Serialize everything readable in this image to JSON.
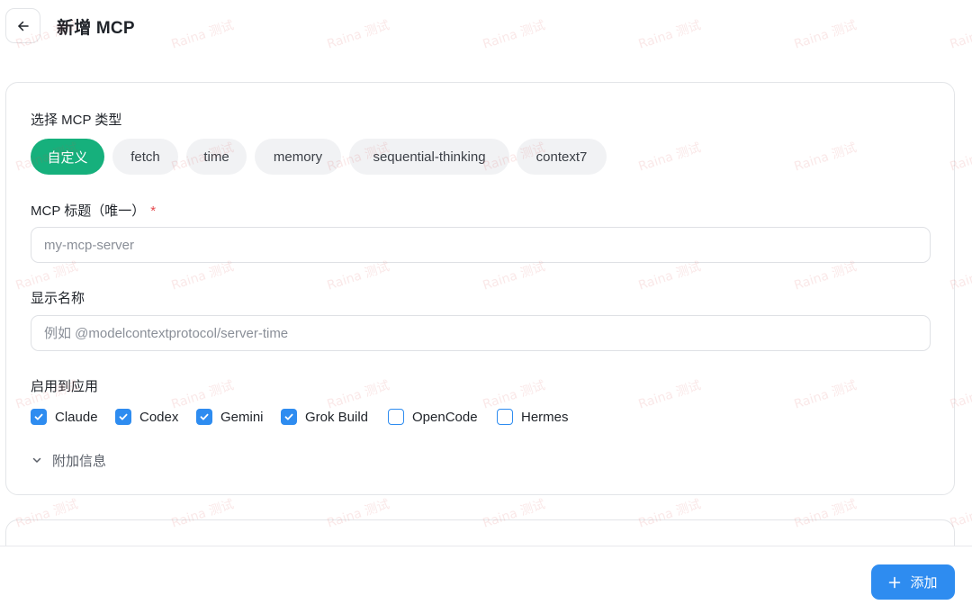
{
  "header": {
    "title": "新增 MCP"
  },
  "mcp_type": {
    "label": "选择 MCP 类型",
    "chips": [
      {
        "label": "自定义",
        "active": true
      },
      {
        "label": "fetch",
        "active": false
      },
      {
        "label": "time",
        "active": false
      },
      {
        "label": "memory",
        "active": false
      },
      {
        "label": "sequential-thinking",
        "active": false
      },
      {
        "label": "context7",
        "active": false
      }
    ]
  },
  "title_field": {
    "label": "MCP 标题（唯一）",
    "required_mark": "*",
    "value": "",
    "placeholder": "my-mcp-server"
  },
  "display_name_field": {
    "label": "显示名称",
    "value": "",
    "placeholder": "例如 @modelcontextprotocol/server-time"
  },
  "apps": {
    "label": "启用到应用",
    "items": [
      {
        "label": "Claude",
        "checked": true
      },
      {
        "label": "Codex",
        "checked": true
      },
      {
        "label": "Gemini",
        "checked": true
      },
      {
        "label": "Grok Build",
        "checked": true
      },
      {
        "label": "OpenCode",
        "checked": false
      },
      {
        "label": "Hermes",
        "checked": false
      }
    ]
  },
  "extra_info": {
    "label": "附加信息",
    "icon": "chevron-down-icon"
  },
  "footer": {
    "add_label": "添加",
    "add_icon": "plus-icon"
  },
  "watermark": {
    "text": "Raina 测试"
  },
  "colors": {
    "accent_green": "#16b07c",
    "accent_blue": "#2e8cf0"
  }
}
